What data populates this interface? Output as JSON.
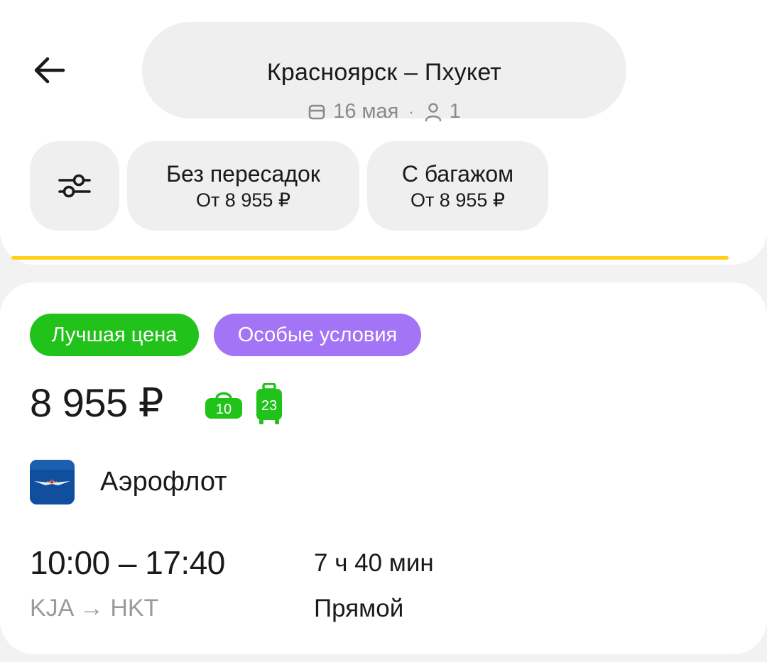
{
  "header": {
    "route_title": "Красноярск – Пхукет",
    "date": "16 мая",
    "separator": "·",
    "passengers": "1"
  },
  "filters": [
    {
      "title": "Без пересадок",
      "subtitle": "От 8 955 ₽"
    },
    {
      "title": "С багажом",
      "subtitle": "От 8 955 ₽"
    }
  ],
  "colors": {
    "accent_yellow": "#ffd01a",
    "badge_green": "#21c21a",
    "badge_purple": "#a374f5",
    "baggage_green": "#21c21a"
  },
  "result": {
    "badges": [
      "Лучшая цена",
      "Особые условия"
    ],
    "price": "8 955 ₽",
    "hand_luggage_kg": "10",
    "baggage_kg": "23",
    "airline": "Аэрофлот",
    "times": "10:00 – 17:40",
    "airports": "KJA → HKT",
    "duration": "7 ч 40 мин",
    "flight_type": "Прямой"
  },
  "icons": [
    "arrow-left-icon",
    "calendar-icon",
    "person-icon",
    "filter-sliders-icon",
    "hand-luggage-icon",
    "suitcase-icon",
    "aeroflot-logo"
  ]
}
